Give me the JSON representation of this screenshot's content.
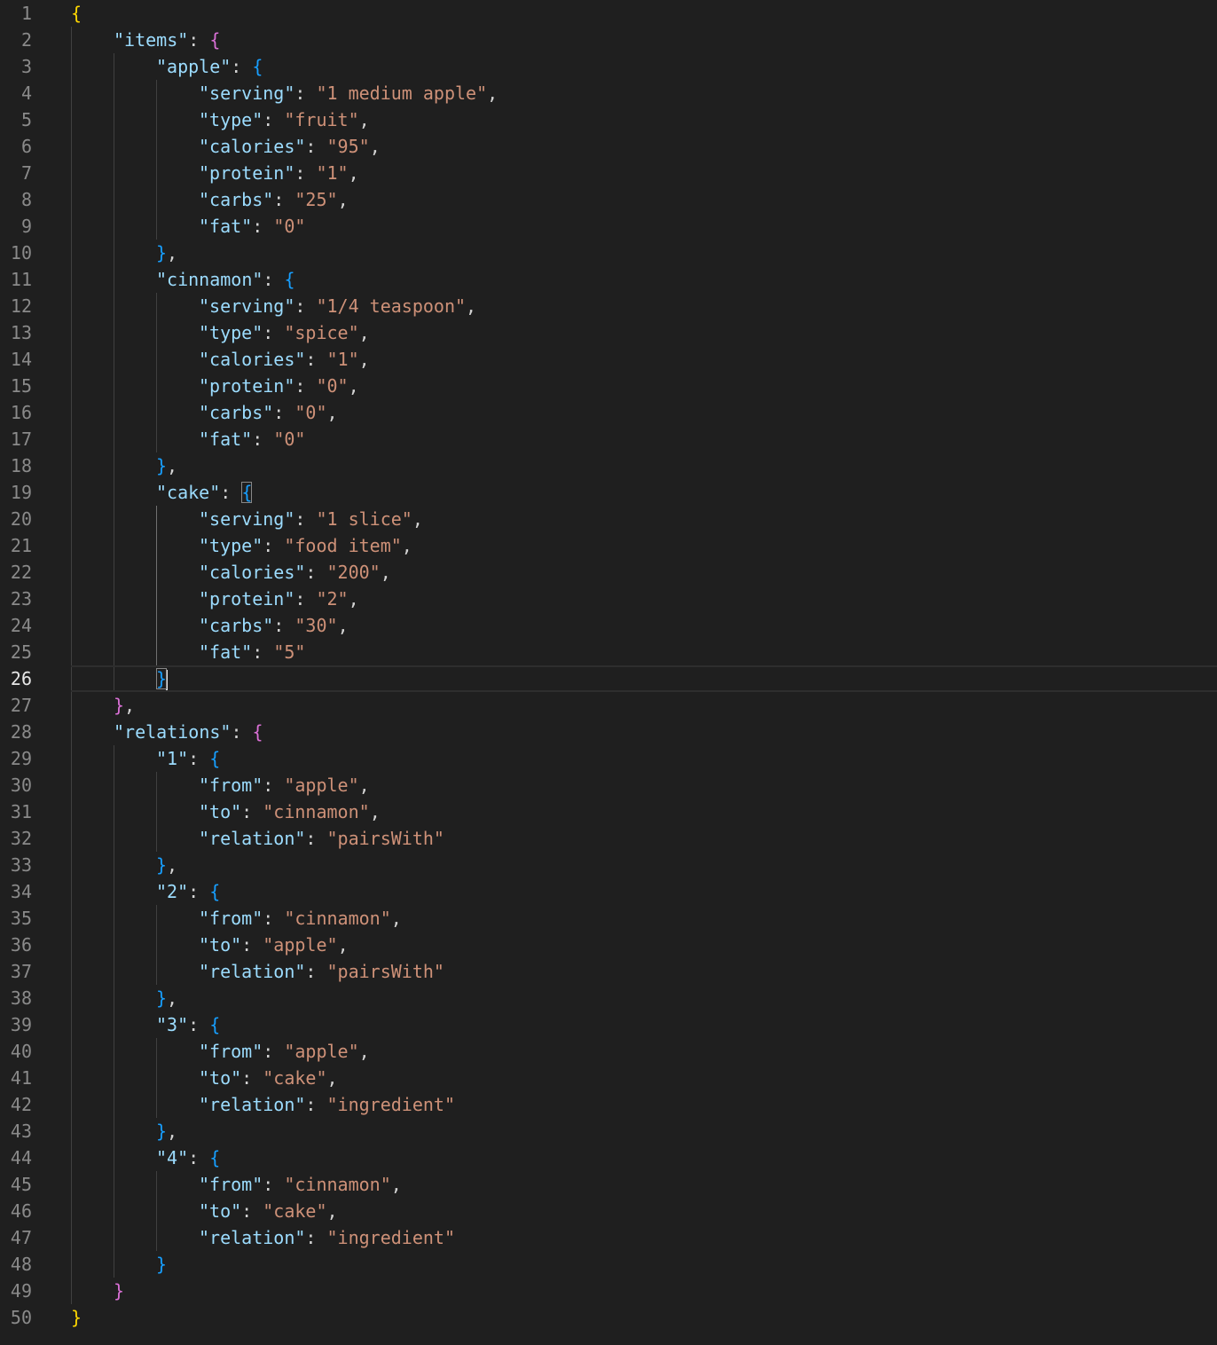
{
  "editor": {
    "current_line": 26,
    "lines": [
      {
        "n": "1",
        "indent": 0,
        "tokens": [
          {
            "t": "{",
            "c": "b1"
          }
        ]
      },
      {
        "n": "2",
        "indent": 1,
        "tokens": [
          {
            "t": "\"items\"",
            "c": "key"
          },
          {
            "t": ": ",
            "c": "punc"
          },
          {
            "t": "{",
            "c": "b2"
          }
        ]
      },
      {
        "n": "3",
        "indent": 2,
        "tokens": [
          {
            "t": "\"apple\"",
            "c": "key"
          },
          {
            "t": ": ",
            "c": "punc"
          },
          {
            "t": "{",
            "c": "b3"
          }
        ]
      },
      {
        "n": "4",
        "indent": 3,
        "tokens": [
          {
            "t": "\"serving\"",
            "c": "key"
          },
          {
            "t": ": ",
            "c": "punc"
          },
          {
            "t": "\"1 medium apple\"",
            "c": "str"
          },
          {
            "t": ",",
            "c": "punc"
          }
        ]
      },
      {
        "n": "5",
        "indent": 3,
        "tokens": [
          {
            "t": "\"type\"",
            "c": "key"
          },
          {
            "t": ": ",
            "c": "punc"
          },
          {
            "t": "\"fruit\"",
            "c": "str"
          },
          {
            "t": ",",
            "c": "punc"
          }
        ]
      },
      {
        "n": "6",
        "indent": 3,
        "tokens": [
          {
            "t": "\"calories\"",
            "c": "key"
          },
          {
            "t": ": ",
            "c": "punc"
          },
          {
            "t": "\"95\"",
            "c": "str"
          },
          {
            "t": ",",
            "c": "punc"
          }
        ]
      },
      {
        "n": "7",
        "indent": 3,
        "tokens": [
          {
            "t": "\"protein\"",
            "c": "key"
          },
          {
            "t": ": ",
            "c": "punc"
          },
          {
            "t": "\"1\"",
            "c": "str"
          },
          {
            "t": ",",
            "c": "punc"
          }
        ]
      },
      {
        "n": "8",
        "indent": 3,
        "tokens": [
          {
            "t": "\"carbs\"",
            "c": "key"
          },
          {
            "t": ": ",
            "c": "punc"
          },
          {
            "t": "\"25\"",
            "c": "str"
          },
          {
            "t": ",",
            "c": "punc"
          }
        ]
      },
      {
        "n": "9",
        "indent": 3,
        "tokens": [
          {
            "t": "\"fat\"",
            "c": "key"
          },
          {
            "t": ": ",
            "c": "punc"
          },
          {
            "t": "\"0\"",
            "c": "str"
          }
        ]
      },
      {
        "n": "10",
        "indent": 2,
        "tokens": [
          {
            "t": "}",
            "c": "b3"
          },
          {
            "t": ",",
            "c": "punc"
          }
        ]
      },
      {
        "n": "11",
        "indent": 2,
        "tokens": [
          {
            "t": "\"cinnamon\"",
            "c": "key"
          },
          {
            "t": ": ",
            "c": "punc"
          },
          {
            "t": "{",
            "c": "b3"
          }
        ]
      },
      {
        "n": "12",
        "indent": 3,
        "tokens": [
          {
            "t": "\"serving\"",
            "c": "key"
          },
          {
            "t": ": ",
            "c": "punc"
          },
          {
            "t": "\"1/4 teaspoon\"",
            "c": "str"
          },
          {
            "t": ",",
            "c": "punc"
          }
        ]
      },
      {
        "n": "13",
        "indent": 3,
        "tokens": [
          {
            "t": "\"type\"",
            "c": "key"
          },
          {
            "t": ": ",
            "c": "punc"
          },
          {
            "t": "\"spice\"",
            "c": "str"
          },
          {
            "t": ",",
            "c": "punc"
          }
        ]
      },
      {
        "n": "14",
        "indent": 3,
        "tokens": [
          {
            "t": "\"calories\"",
            "c": "key"
          },
          {
            "t": ": ",
            "c": "punc"
          },
          {
            "t": "\"1\"",
            "c": "str"
          },
          {
            "t": ",",
            "c": "punc"
          }
        ]
      },
      {
        "n": "15",
        "indent": 3,
        "tokens": [
          {
            "t": "\"protein\"",
            "c": "key"
          },
          {
            "t": ": ",
            "c": "punc"
          },
          {
            "t": "\"0\"",
            "c": "str"
          },
          {
            "t": ",",
            "c": "punc"
          }
        ]
      },
      {
        "n": "16",
        "indent": 3,
        "tokens": [
          {
            "t": "\"carbs\"",
            "c": "key"
          },
          {
            "t": ": ",
            "c": "punc"
          },
          {
            "t": "\"0\"",
            "c": "str"
          },
          {
            "t": ",",
            "c": "punc"
          }
        ]
      },
      {
        "n": "17",
        "indent": 3,
        "tokens": [
          {
            "t": "\"fat\"",
            "c": "key"
          },
          {
            "t": ": ",
            "c": "punc"
          },
          {
            "t": "\"0\"",
            "c": "str"
          }
        ]
      },
      {
        "n": "18",
        "indent": 2,
        "tokens": [
          {
            "t": "}",
            "c": "b3"
          },
          {
            "t": ",",
            "c": "punc"
          }
        ]
      },
      {
        "n": "19",
        "indent": 2,
        "tokens": [
          {
            "t": "\"cake\"",
            "c": "key"
          },
          {
            "t": ": ",
            "c": "punc"
          },
          {
            "t": "{",
            "c": "b3",
            "match": true
          }
        ]
      },
      {
        "n": "20",
        "indent": 3,
        "tokens": [
          {
            "t": "\"serving\"",
            "c": "key"
          },
          {
            "t": ": ",
            "c": "punc"
          },
          {
            "t": "\"1 slice\"",
            "c": "str"
          },
          {
            "t": ",",
            "c": "punc"
          }
        ]
      },
      {
        "n": "21",
        "indent": 3,
        "tokens": [
          {
            "t": "\"type\"",
            "c": "key"
          },
          {
            "t": ": ",
            "c": "punc"
          },
          {
            "t": "\"food item\"",
            "c": "str"
          },
          {
            "t": ",",
            "c": "punc"
          }
        ]
      },
      {
        "n": "22",
        "indent": 3,
        "tokens": [
          {
            "t": "\"calories\"",
            "c": "key"
          },
          {
            "t": ": ",
            "c": "punc"
          },
          {
            "t": "\"200\"",
            "c": "str"
          },
          {
            "t": ",",
            "c": "punc"
          }
        ]
      },
      {
        "n": "23",
        "indent": 3,
        "tokens": [
          {
            "t": "\"protein\"",
            "c": "key"
          },
          {
            "t": ": ",
            "c": "punc"
          },
          {
            "t": "\"2\"",
            "c": "str"
          },
          {
            "t": ",",
            "c": "punc"
          }
        ]
      },
      {
        "n": "24",
        "indent": 3,
        "tokens": [
          {
            "t": "\"carbs\"",
            "c": "key"
          },
          {
            "t": ": ",
            "c": "punc"
          },
          {
            "t": "\"30\"",
            "c": "str"
          },
          {
            "t": ",",
            "c": "punc"
          }
        ]
      },
      {
        "n": "25",
        "indent": 3,
        "tokens": [
          {
            "t": "\"fat\"",
            "c": "key"
          },
          {
            "t": ": ",
            "c": "punc"
          },
          {
            "t": "\"5\"",
            "c": "str"
          }
        ]
      },
      {
        "n": "26",
        "indent": 2,
        "tokens": [
          {
            "t": "}",
            "c": "b3",
            "match": true,
            "cursor": true
          }
        ]
      },
      {
        "n": "27",
        "indent": 1,
        "tokens": [
          {
            "t": "}",
            "c": "b2"
          },
          {
            "t": ",",
            "c": "punc"
          }
        ]
      },
      {
        "n": "28",
        "indent": 1,
        "tokens": [
          {
            "t": "\"relations\"",
            "c": "key"
          },
          {
            "t": ": ",
            "c": "punc"
          },
          {
            "t": "{",
            "c": "b2"
          }
        ]
      },
      {
        "n": "29",
        "indent": 2,
        "tokens": [
          {
            "t": "\"1\"",
            "c": "key"
          },
          {
            "t": ": ",
            "c": "punc"
          },
          {
            "t": "{",
            "c": "b3"
          }
        ]
      },
      {
        "n": "30",
        "indent": 3,
        "tokens": [
          {
            "t": "\"from\"",
            "c": "key"
          },
          {
            "t": ": ",
            "c": "punc"
          },
          {
            "t": "\"apple\"",
            "c": "str"
          },
          {
            "t": ",",
            "c": "punc"
          }
        ]
      },
      {
        "n": "31",
        "indent": 3,
        "tokens": [
          {
            "t": "\"to\"",
            "c": "key"
          },
          {
            "t": ": ",
            "c": "punc"
          },
          {
            "t": "\"cinnamon\"",
            "c": "str"
          },
          {
            "t": ",",
            "c": "punc"
          }
        ]
      },
      {
        "n": "32",
        "indent": 3,
        "tokens": [
          {
            "t": "\"relation\"",
            "c": "key"
          },
          {
            "t": ": ",
            "c": "punc"
          },
          {
            "t": "\"pairsWith\"",
            "c": "str"
          }
        ]
      },
      {
        "n": "33",
        "indent": 2,
        "tokens": [
          {
            "t": "}",
            "c": "b3"
          },
          {
            "t": ",",
            "c": "punc"
          }
        ]
      },
      {
        "n": "34",
        "indent": 2,
        "tokens": [
          {
            "t": "\"2\"",
            "c": "key"
          },
          {
            "t": ": ",
            "c": "punc"
          },
          {
            "t": "{",
            "c": "b3"
          }
        ]
      },
      {
        "n": "35",
        "indent": 3,
        "tokens": [
          {
            "t": "\"from\"",
            "c": "key"
          },
          {
            "t": ": ",
            "c": "punc"
          },
          {
            "t": "\"cinnamon\"",
            "c": "str"
          },
          {
            "t": ",",
            "c": "punc"
          }
        ]
      },
      {
        "n": "36",
        "indent": 3,
        "tokens": [
          {
            "t": "\"to\"",
            "c": "key"
          },
          {
            "t": ": ",
            "c": "punc"
          },
          {
            "t": "\"apple\"",
            "c": "str"
          },
          {
            "t": ",",
            "c": "punc"
          }
        ]
      },
      {
        "n": "37",
        "indent": 3,
        "tokens": [
          {
            "t": "\"relation\"",
            "c": "key"
          },
          {
            "t": ": ",
            "c": "punc"
          },
          {
            "t": "\"pairsWith\"",
            "c": "str"
          }
        ]
      },
      {
        "n": "38",
        "indent": 2,
        "tokens": [
          {
            "t": "}",
            "c": "b3"
          },
          {
            "t": ",",
            "c": "punc"
          }
        ]
      },
      {
        "n": "39",
        "indent": 2,
        "tokens": [
          {
            "t": "\"3\"",
            "c": "key"
          },
          {
            "t": ": ",
            "c": "punc"
          },
          {
            "t": "{",
            "c": "b3"
          }
        ]
      },
      {
        "n": "40",
        "indent": 3,
        "tokens": [
          {
            "t": "\"from\"",
            "c": "key"
          },
          {
            "t": ": ",
            "c": "punc"
          },
          {
            "t": "\"apple\"",
            "c": "str"
          },
          {
            "t": ",",
            "c": "punc"
          }
        ]
      },
      {
        "n": "41",
        "indent": 3,
        "tokens": [
          {
            "t": "\"to\"",
            "c": "key"
          },
          {
            "t": ": ",
            "c": "punc"
          },
          {
            "t": "\"cake\"",
            "c": "str"
          },
          {
            "t": ",",
            "c": "punc"
          }
        ]
      },
      {
        "n": "42",
        "indent": 3,
        "tokens": [
          {
            "t": "\"relation\"",
            "c": "key"
          },
          {
            "t": ": ",
            "c": "punc"
          },
          {
            "t": "\"ingredient\"",
            "c": "str"
          }
        ]
      },
      {
        "n": "43",
        "indent": 2,
        "tokens": [
          {
            "t": "}",
            "c": "b3"
          },
          {
            "t": ",",
            "c": "punc"
          }
        ]
      },
      {
        "n": "44",
        "indent": 2,
        "tokens": [
          {
            "t": "\"4\"",
            "c": "key"
          },
          {
            "t": ": ",
            "c": "punc"
          },
          {
            "t": "{",
            "c": "b3"
          }
        ]
      },
      {
        "n": "45",
        "indent": 3,
        "tokens": [
          {
            "t": "\"from\"",
            "c": "key"
          },
          {
            "t": ": ",
            "c": "punc"
          },
          {
            "t": "\"cinnamon\"",
            "c": "str"
          },
          {
            "t": ",",
            "c": "punc"
          }
        ]
      },
      {
        "n": "46",
        "indent": 3,
        "tokens": [
          {
            "t": "\"to\"",
            "c": "key"
          },
          {
            "t": ": ",
            "c": "punc"
          },
          {
            "t": "\"cake\"",
            "c": "str"
          },
          {
            "t": ",",
            "c": "punc"
          }
        ]
      },
      {
        "n": "47",
        "indent": 3,
        "tokens": [
          {
            "t": "\"relation\"",
            "c": "key"
          },
          {
            "t": ": ",
            "c": "punc"
          },
          {
            "t": "\"ingredient\"",
            "c": "str"
          }
        ]
      },
      {
        "n": "48",
        "indent": 2,
        "tokens": [
          {
            "t": "}",
            "c": "b3"
          }
        ]
      },
      {
        "n": "49",
        "indent": 1,
        "tokens": [
          {
            "t": "}",
            "c": "b2"
          }
        ]
      },
      {
        "n": "50",
        "indent": 0,
        "tokens": [
          {
            "t": "}",
            "c": "b1"
          }
        ]
      }
    ]
  }
}
